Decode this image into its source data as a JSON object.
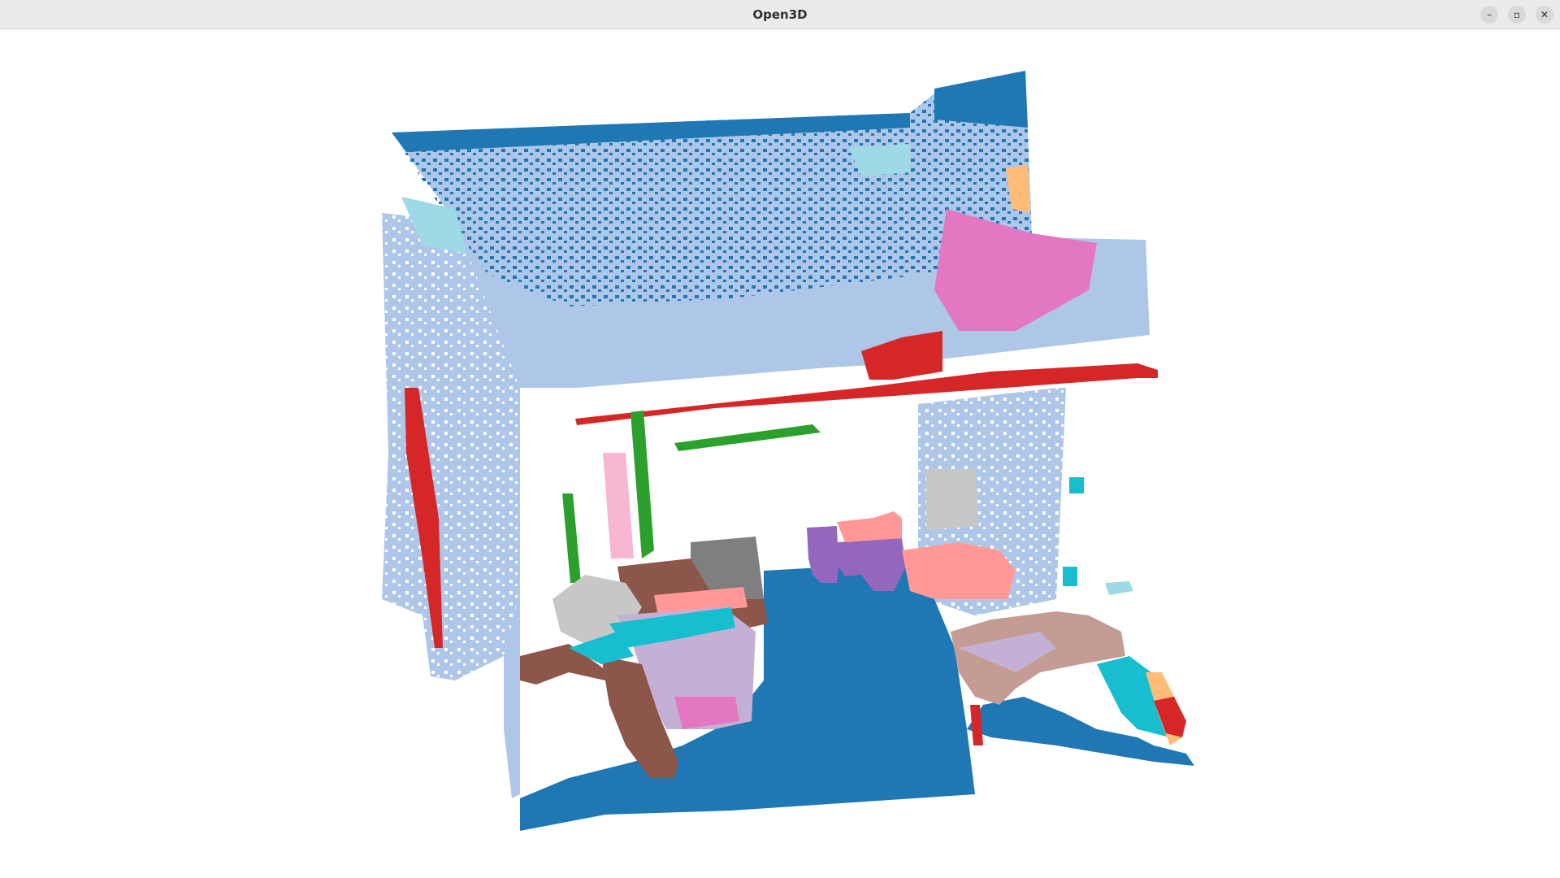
{
  "window": {
    "title": "Open3D",
    "controls": {
      "minimize": "–",
      "maximize": "▫",
      "close": "✕"
    }
  },
  "scene": {
    "description_colors": {
      "floor_ceiling": "#1f77b4",
      "walls": "#aec7e8",
      "red": "#d62728",
      "green": "#2ca02c",
      "pink": "#e377c2",
      "light_pink": "#f7b6d2",
      "purple": "#9467bd",
      "light_purple": "#c5b0d5",
      "brown": "#8c564b",
      "tan": "#c49c94",
      "salmon": "#ff9896",
      "orange_light": "#ffbb78",
      "cyan": "#17becf",
      "light_cyan": "#9edae5",
      "gray": "#7f7f7f",
      "light_gray": "#c7c7c7",
      "olive": "#bcbd22"
    }
  }
}
